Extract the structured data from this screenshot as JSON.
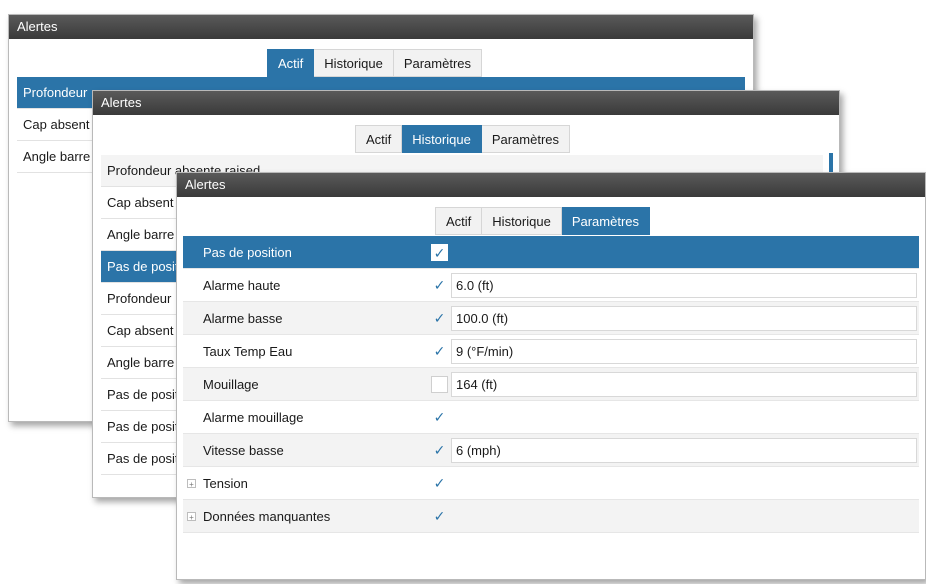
{
  "windows": {
    "back": {
      "title": "Alertes",
      "tabs": [
        {
          "label": "Actif",
          "active": true
        },
        {
          "label": "Historique",
          "active": false
        },
        {
          "label": "Paramètres",
          "active": false
        }
      ],
      "rows": [
        "Profondeur",
        "Cap absent",
        "Angle barre"
      ]
    },
    "middle": {
      "title": "Alertes",
      "tabs": [
        {
          "label": "Actif",
          "active": false
        },
        {
          "label": "Historique",
          "active": true
        },
        {
          "label": "Paramètres",
          "active": false
        }
      ],
      "rows": [
        "Profondeur absente raised",
        "Cap absent r",
        "Angle barre",
        "Pas de posit",
        "Profondeur",
        "Cap absent r",
        "Angle barre",
        "Pas de posit",
        "Pas de posit",
        "Pas de posit"
      ]
    },
    "front": {
      "title": "Alertes",
      "tabs": [
        {
          "label": "Actif",
          "active": false
        },
        {
          "label": "Historique",
          "active": false
        },
        {
          "label": "Paramètres",
          "active": true
        }
      ],
      "settings": [
        {
          "label": "Pas de position",
          "checked": true,
          "value": null
        },
        {
          "label": "Alarme haute",
          "checked": true,
          "value": "6.0 (ft)"
        },
        {
          "label": "Alarme basse",
          "checked": true,
          "value": "100.0 (ft)"
        },
        {
          "label": "Taux Temp Eau",
          "checked": true,
          "value": "9 (°F/min)"
        },
        {
          "label": "Mouillage",
          "checked": false,
          "value": "164 (ft)"
        },
        {
          "label": "Alarme mouillage",
          "checked": true,
          "value": null
        },
        {
          "label": "Vitesse basse",
          "checked": true,
          "value": "6 (mph)"
        },
        {
          "label": "Tension",
          "checked": true,
          "value": null,
          "expandable": true
        },
        {
          "label": "Données manquantes",
          "checked": true,
          "value": null,
          "expandable": true
        }
      ]
    }
  },
  "colors": {
    "accent": "#2b74a8",
    "titlebar": "#444444"
  },
  "icons": {
    "check": "✓",
    "expander": "+"
  }
}
